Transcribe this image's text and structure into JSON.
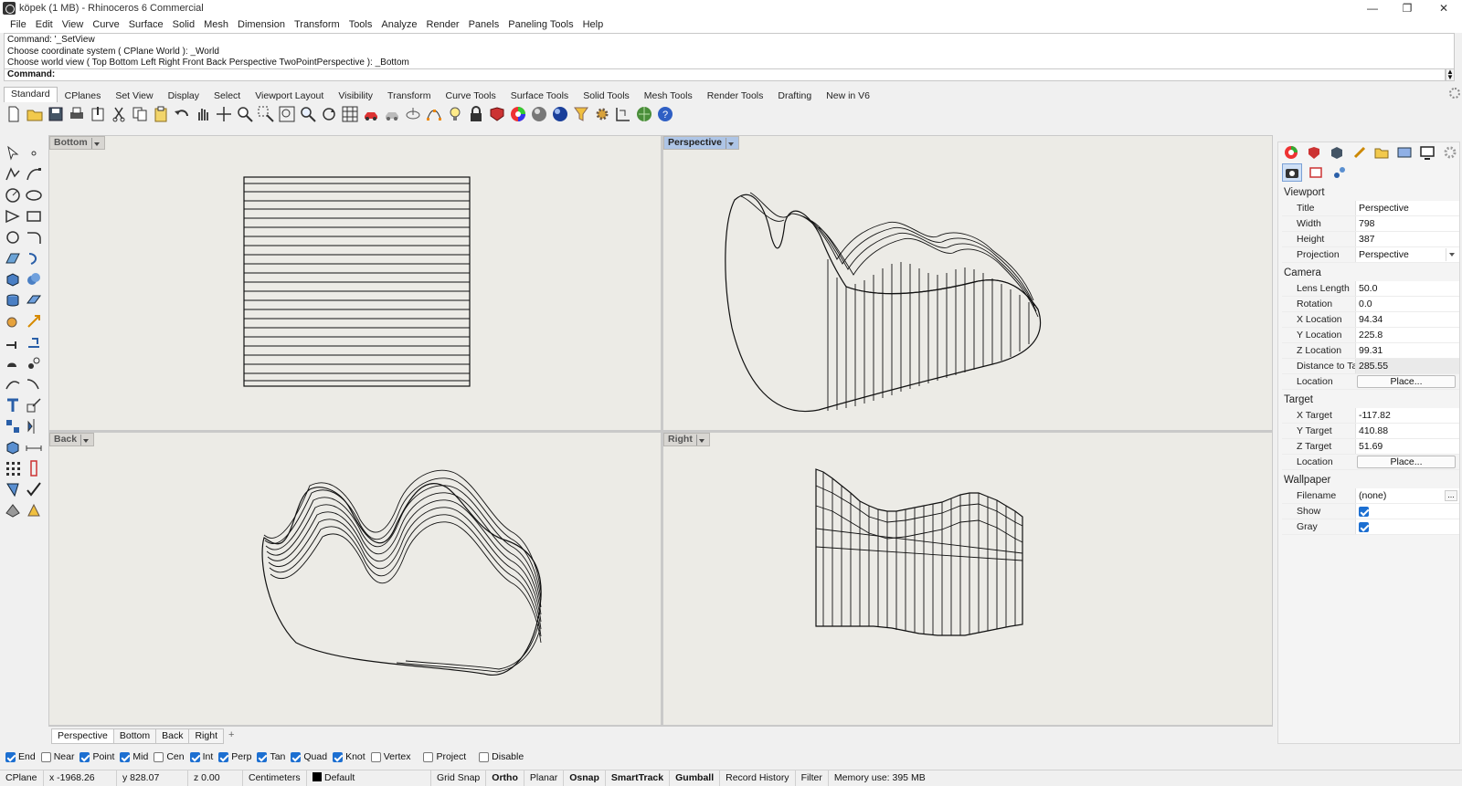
{
  "window": {
    "title": "köpek (1 MB) - Rhinoceros 6 Commercial",
    "minimize": "—",
    "maximize": "❐",
    "close": "✕"
  },
  "menu": [
    "File",
    "Edit",
    "View",
    "Curve",
    "Surface",
    "Solid",
    "Mesh",
    "Dimension",
    "Transform",
    "Tools",
    "Analyze",
    "Render",
    "Panels",
    "Paneling Tools",
    "Help"
  ],
  "command": {
    "history": [
      "Command: '_SetView",
      "Choose coordinate system ( CPlane  World ): _World",
      "Choose world view ( Top  Bottom  Left  Right  Front  Back  Perspective  TwoPointPerspective ): _Bottom"
    ],
    "prompt": "Command:"
  },
  "toolbar_tabs": [
    "Standard",
    "CPlanes",
    "Set View",
    "Display",
    "Select",
    "Viewport Layout",
    "Visibility",
    "Transform",
    "Curve Tools",
    "Surface Tools",
    "Solid Tools",
    "Mesh Tools",
    "Render Tools",
    "Drafting",
    "New in V6"
  ],
  "viewports": {
    "top_left": {
      "title": "Bottom"
    },
    "top_right": {
      "title": "Perspective"
    },
    "bottom_left": {
      "title": "Back"
    },
    "bottom_right": {
      "title": "Right"
    }
  },
  "viewport_tabs": [
    "Perspective",
    "Bottom",
    "Back",
    "Right"
  ],
  "viewport_tab_add": "+",
  "osnaps": [
    {
      "label": "End",
      "checked": true
    },
    {
      "label": "Near",
      "checked": false
    },
    {
      "label": "Point",
      "checked": true
    },
    {
      "label": "Mid",
      "checked": true
    },
    {
      "label": "Cen",
      "checked": false
    },
    {
      "label": "Int",
      "checked": true
    },
    {
      "label": "Perp",
      "checked": true
    },
    {
      "label": "Tan",
      "checked": true
    },
    {
      "label": "Quad",
      "checked": true
    },
    {
      "label": "Knot",
      "checked": true
    },
    {
      "label": "Vertex",
      "checked": false
    },
    {
      "label": "Project",
      "checked": false
    },
    {
      "label": "Disable",
      "checked": false
    }
  ],
  "status": {
    "cplane": "CPlane",
    "x": "x -1968.26",
    "y": "y 828.07",
    "z": "z 0.00",
    "units": "Centimeters",
    "layer": "Default",
    "grid_snap": "Grid Snap",
    "ortho": "Ortho",
    "planar": "Planar",
    "osnap": "Osnap",
    "smarttrack": "SmartTrack",
    "gumball": "Gumball",
    "record_history": "Record History",
    "filter": "Filter",
    "memory": "Memory use: 395 MB"
  },
  "panel": {
    "viewport_section": "Viewport",
    "title_label": "Title",
    "title_value": "Perspective",
    "width_label": "Width",
    "width_value": "798",
    "height_label": "Height",
    "height_value": "387",
    "projection_label": "Projection",
    "projection_value": "Perspective",
    "camera_section": "Camera",
    "lens_label": "Lens Length",
    "lens_value": "50.0",
    "rotation_label": "Rotation",
    "rotation_value": "0.0",
    "xloc_label": "X Location",
    "xloc_value": "94.34",
    "yloc_label": "Y Location",
    "yloc_value": "225.8",
    "zloc_label": "Z Location",
    "zloc_value": "99.31",
    "dist_label": "Distance to Tar...",
    "dist_value": "285.55",
    "cam_location_label": "Location",
    "place_button": "Place...",
    "target_section": "Target",
    "xt_label": "X Target",
    "xt_value": "-117.82",
    "yt_label": "Y Target",
    "yt_value": "410.88",
    "zt_label": "Z Target",
    "zt_value": "51.69",
    "target_location_label": "Location",
    "wallpaper_section": "Wallpaper",
    "filename_label": "Filename",
    "filename_value": "(none)",
    "filename_browse": "...",
    "show_label": "Show",
    "show_checked": true,
    "gray_label": "Gray",
    "gray_checked": true
  },
  "colors": {
    "viewport_bg": "#ecebe6",
    "active_vp_title": "#aec5e6",
    "checkbox": "#1c6fd1"
  }
}
